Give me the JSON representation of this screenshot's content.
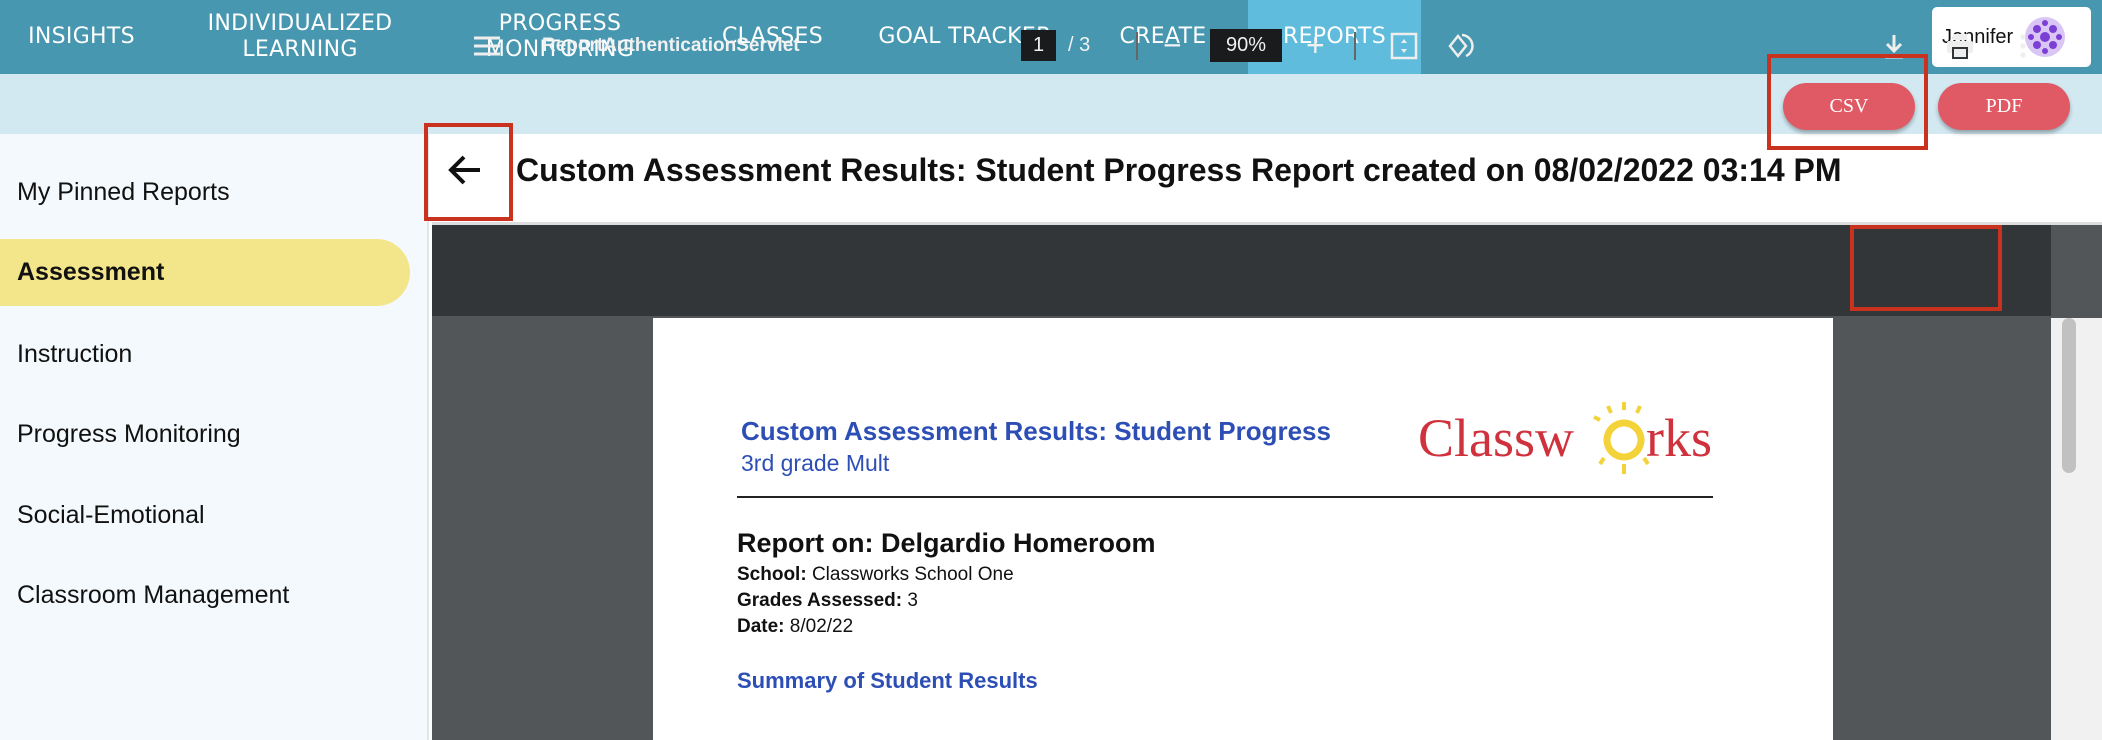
{
  "nav": {
    "items": [
      "INSIGHTS",
      "INDIVIDUALIZED LEARNING",
      "PROGRESS MONITORING",
      "CLASSES",
      "GOAL TRACKER",
      "CREATE",
      "REPORTS"
    ],
    "active": "REPORTS",
    "user": "Jennifer"
  },
  "export": {
    "csv": "CSV",
    "pdf": "PDF"
  },
  "sidebar": {
    "items": [
      "My Pinned Reports",
      "Assessment",
      "Instruction",
      "Progress Monitoring",
      "Social-Emotional",
      "Classroom Management"
    ],
    "active": "Assessment"
  },
  "page_title": "Custom Assessment Results: Student Progress Report created on 08/02/2022 03:14 PM",
  "viewer": {
    "doc_name": "ReportAuthenticationServlet",
    "current_page": "1",
    "total_pages": "/ 3",
    "zoom": "90%"
  },
  "report": {
    "title": "Custom Assessment Results: Student Progress",
    "subtitle": "3rd grade Mult",
    "logo": "Classworks",
    "report_on_label": "Report on:",
    "report_on": "Delgardio Homeroom",
    "school_label": "School:",
    "school": "Classworks School One",
    "grades_label": "Grades Assessed:",
    "grades": "3",
    "date_label": "Date:",
    "date": "8/02/22",
    "summary_heading": "Summary of Student Results"
  },
  "colors": {
    "nav": "#4897b0",
    "nav_active": "#5fbcdc",
    "pill": "#e05a66",
    "highlight": "#f3e58a",
    "annotation": "#c8321f"
  }
}
